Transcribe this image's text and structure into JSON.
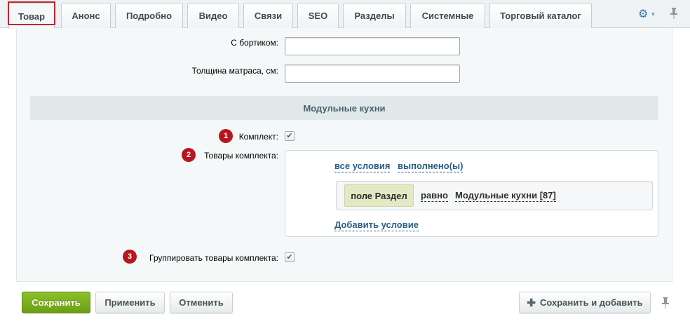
{
  "tabs": [
    {
      "label": "Товар",
      "active": true
    },
    {
      "label": "Анонс"
    },
    {
      "label": "Подробно"
    },
    {
      "label": "Видео"
    },
    {
      "label": "Связи"
    },
    {
      "label": "SEO"
    },
    {
      "label": "Разделы"
    },
    {
      "label": "Системные"
    },
    {
      "label": "Торговый каталог"
    }
  ],
  "toolbar": {
    "settings_icon": "gear-icon",
    "pin_icon": "pin-icon"
  },
  "fields": {
    "bortik_label": "С бортиком:",
    "bortik_value": "",
    "thickness_label": "Толщина матраса, см:",
    "thickness_value": ""
  },
  "section": {
    "title": "Модульные кухни"
  },
  "kit": {
    "badge": "1",
    "label": "Комплект:",
    "checked": true
  },
  "kit_products": {
    "badge": "2",
    "label": "Товары комплекта:",
    "all_conditions": "все условия",
    "fulfilled": "выполнено(ы)",
    "condition_field": "поле Раздел",
    "condition_operator": "равно",
    "condition_value": "Модульные кухни [87]",
    "add_condition": "Добавить условие"
  },
  "group_kit": {
    "badge": "3",
    "label": "Группировать товары комплекта:",
    "checked": true
  },
  "buttons": {
    "save": "Сохранить",
    "apply": "Применить",
    "cancel": "Отменить",
    "save_and_add": "Сохранить и добавить"
  },
  "colors": {
    "badge": "#b8161e",
    "save_button": "#7aae1e",
    "link": "#2a5e86",
    "tab_highlight": "#c0262e"
  }
}
